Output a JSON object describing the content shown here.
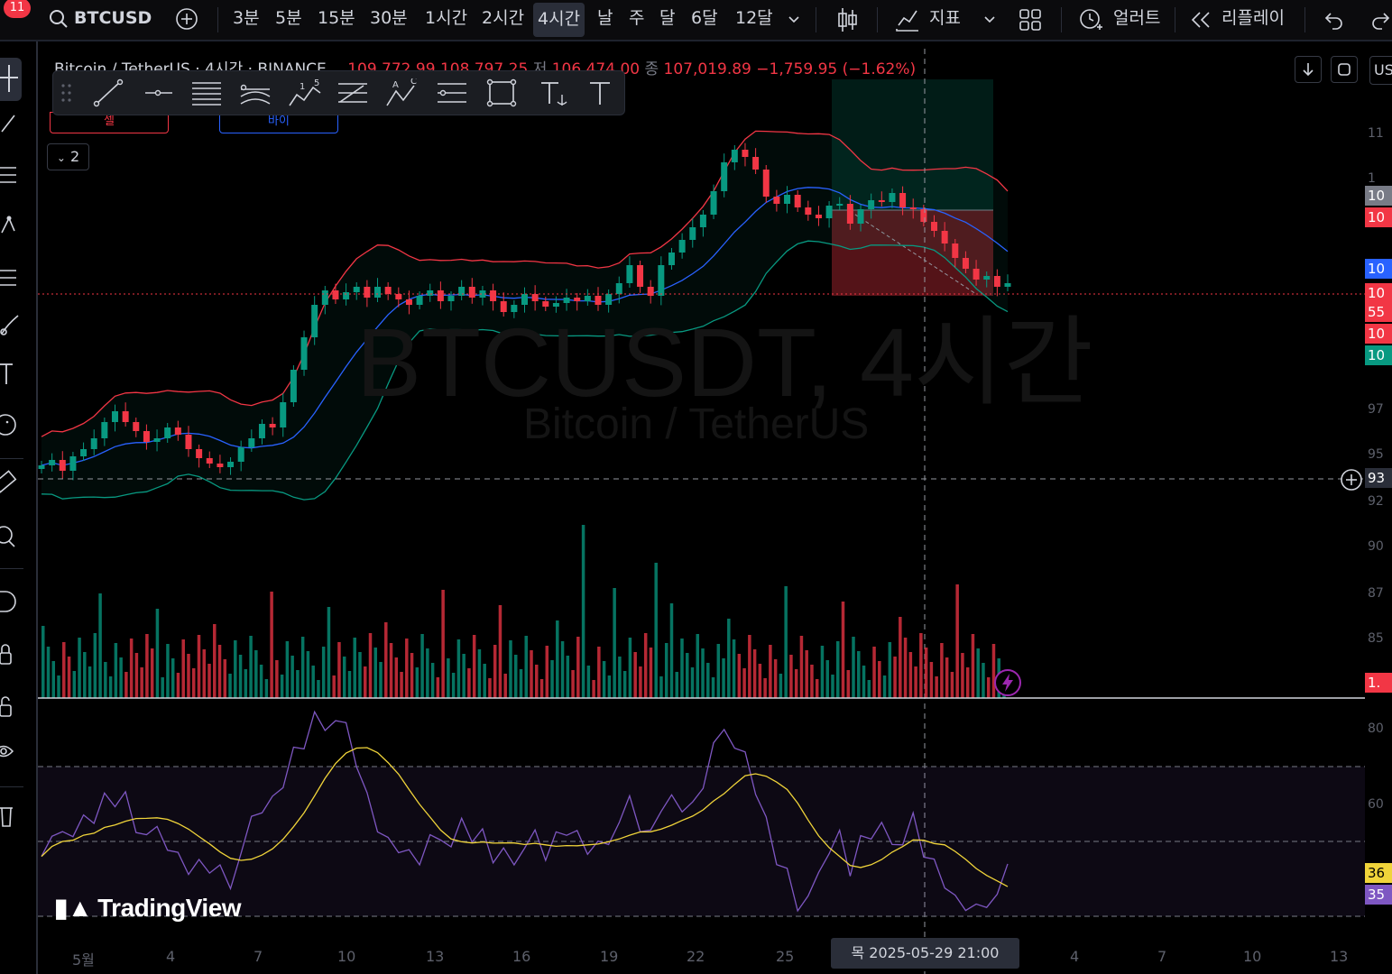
{
  "topbar": {
    "notification_count": "11",
    "symbol": "BTCUSD",
    "intervals": [
      {
        "label": "3분",
        "active": false
      },
      {
        "label": "5분",
        "active": false
      },
      {
        "label": "15분",
        "active": false
      },
      {
        "label": "30분",
        "active": false
      },
      {
        "label": "1시간",
        "active": false
      },
      {
        "label": "2시간",
        "active": false
      },
      {
        "label": "4시간",
        "active": true
      },
      {
        "label": "날",
        "active": false
      },
      {
        "label": "주",
        "active": false
      },
      {
        "label": "달",
        "active": false
      },
      {
        "label": "6달",
        "active": false
      },
      {
        "label": "12달",
        "active": false
      }
    ],
    "indicators_label": "지표",
    "alerts_label": "얼러트",
    "replay_label": "리플레이"
  },
  "legend": {
    "title": "Bitcoin / TetherUS · 4시간 · BINANCE",
    "open_value": "109,772.99",
    "high_value": "108,797.25",
    "low_prefix": "저",
    "low_value": "106,474.00",
    "close_prefix": "종",
    "close_value": "107,019.89",
    "change": "−1,759.95 (−1.62%)"
  },
  "trade": {
    "sell_label": "셀",
    "buy_label": "바이",
    "collapse_count": "2"
  },
  "watermark": {
    "symbol": "BTCUSDT, 4시간",
    "name": "Bitcoin / TetherUS"
  },
  "price_axis": {
    "currency": "US",
    "tags": [
      {
        "text": "10",
        "color": "#787b86"
      },
      {
        "text": "10",
        "color": "#f23645"
      },
      {
        "text": "10",
        "color": "#2962ff"
      },
      {
        "text": "10",
        "color": "#f23645"
      },
      {
        "text": "55",
        "color": "#f23645"
      },
      {
        "text": "10",
        "color": "#f23645"
      },
      {
        "text": "10",
        "color": "#089981"
      },
      {
        "text": "93",
        "color": "#2a2e39"
      },
      {
        "text": "1.",
        "color": "#f23645"
      },
      {
        "text": "36",
        "color": "#f0d43a"
      },
      {
        "text": "35",
        "color": "#7e57c2"
      }
    ],
    "labels": [
      "11",
      "1",
      "97",
      "95",
      "92",
      "90",
      "87",
      "85",
      "80",
      "60"
    ]
  },
  "time_axis": {
    "labels": [
      "5월",
      "4",
      "7",
      "10",
      "13",
      "16",
      "19",
      "22",
      "25",
      "4",
      "7",
      "10",
      "13"
    ],
    "crosshair_label": "목 2025-05-29   21:00"
  },
  "branding": "TradingView",
  "colors": {
    "up": "#089981",
    "down": "#f23645",
    "bb_upper": "#f23645",
    "bb_basis": "#2962ff",
    "bb_lower": "#089981",
    "rsi": "#7e57c2",
    "rsi_ma": "#f0d43a"
  },
  "chart_data": {
    "type": "candlestick",
    "symbol": "BTCUSDT",
    "interval": "4시간",
    "close_series": [
      94400,
      94700,
      94100,
      94900,
      95300,
      95900,
      96800,
      97400,
      96800,
      96300,
      95700,
      95900,
      96500,
      96100,
      95300,
      94800,
      94500,
      94300,
      94600,
      95400,
      95900,
      96700,
      96500,
      97900,
      99700,
      101500,
      103300,
      104100,
      103600,
      104000,
      104300,
      103700,
      104300,
      103900,
      103600,
      103300,
      103800,
      104100,
      103500,
      103800,
      104300,
      103700,
      104100,
      103500,
      102900,
      103300,
      103900,
      103500,
      103200,
      103400,
      103700,
      103500,
      103800,
      103300,
      103900,
      104500,
      105500,
      104300,
      103800,
      105500,
      106200,
      106900,
      107600,
      108300,
      109600,
      111200,
      111900,
      111500,
      110800,
      109300,
      108900,
      109400,
      108700,
      108300,
      108100,
      108800,
      108900,
      107800,
      108600,
      109100,
      109000,
      109500,
      108700,
      108600,
      107900,
      107400,
      106700,
      105900,
      105300,
      104700,
      104900,
      104300,
      104500
    ]
  }
}
